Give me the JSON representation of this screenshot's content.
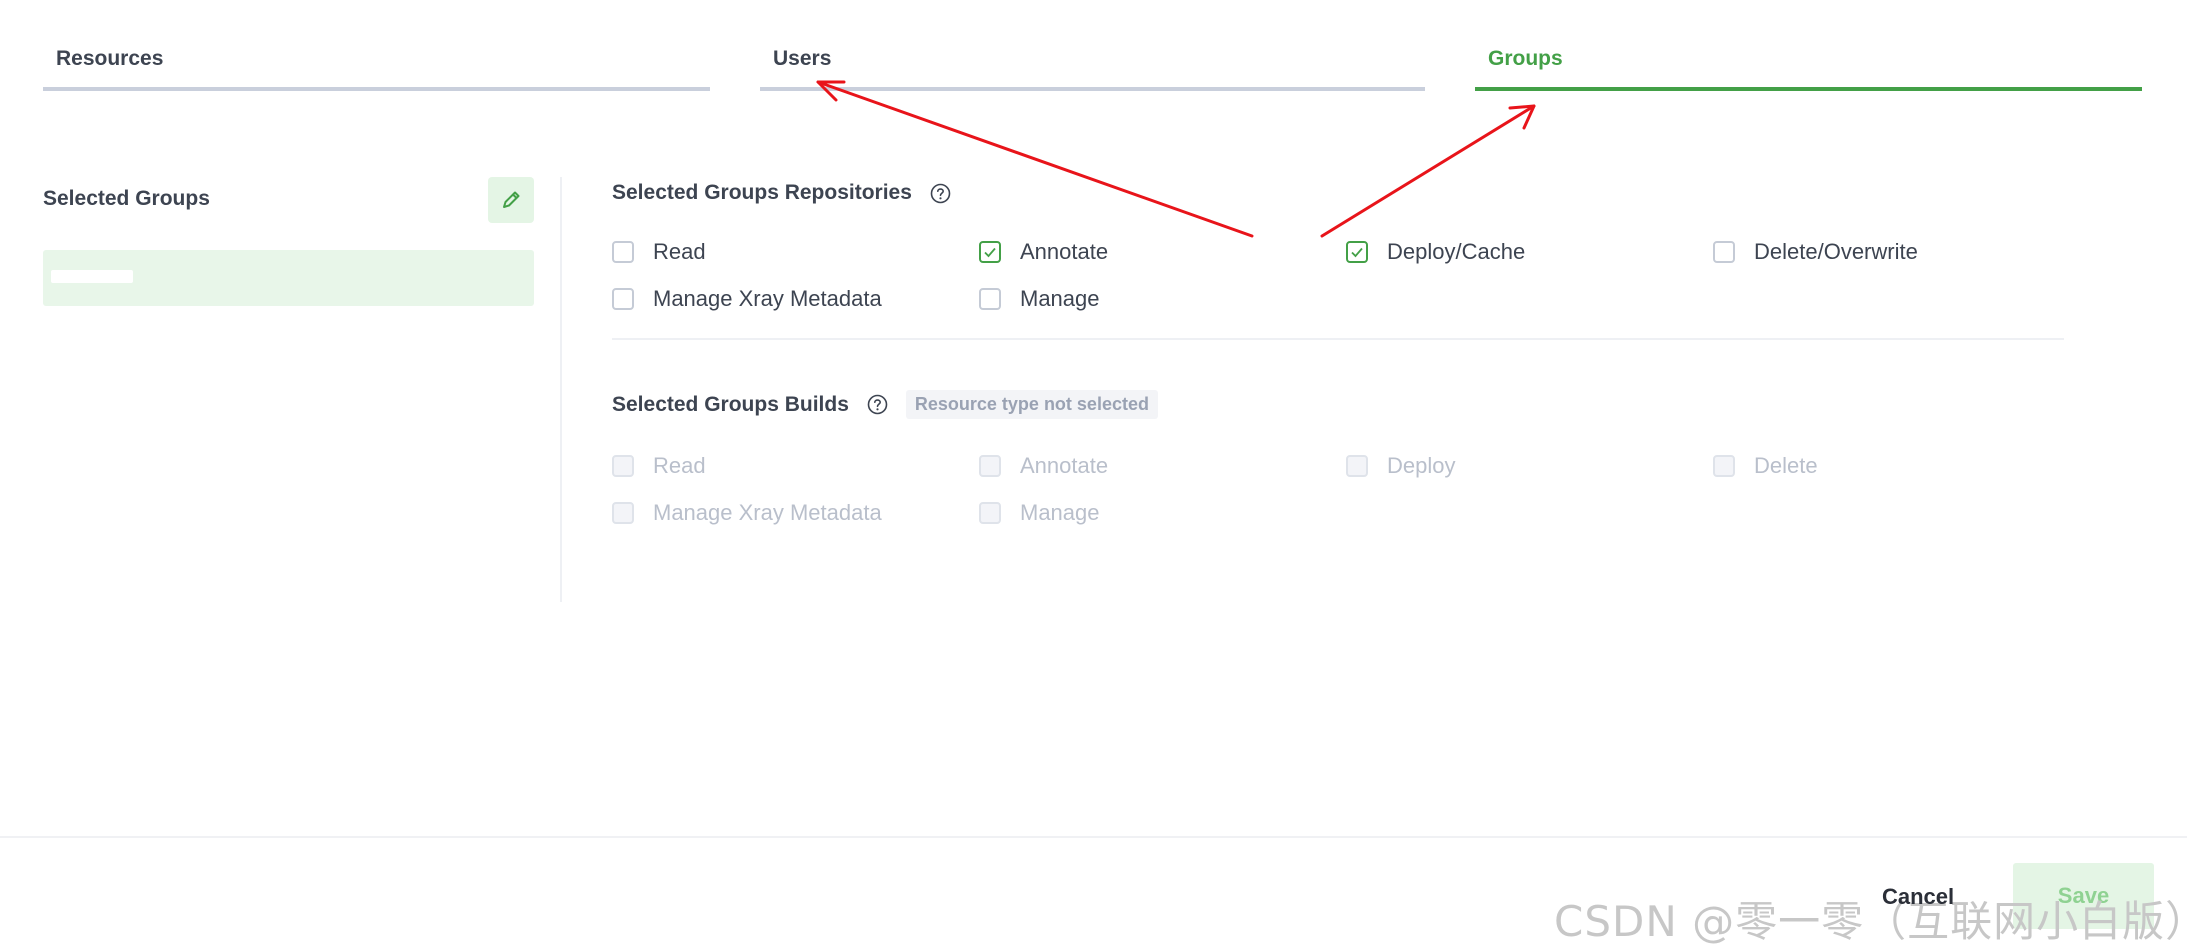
{
  "tabs": [
    {
      "label": "Resources",
      "active": false
    },
    {
      "label": "Users",
      "active": false
    },
    {
      "label": "Groups",
      "active": true
    }
  ],
  "left_panel": {
    "title": "Selected Groups",
    "edit_icon": "pencil-icon",
    "selected_item": ""
  },
  "repositories": {
    "title": "Selected Groups Repositories",
    "help_icon": "question-circle-icon",
    "permissions": [
      {
        "label": "Read",
        "checked": false
      },
      {
        "label": "Annotate",
        "checked": true
      },
      {
        "label": "Deploy/Cache",
        "checked": true
      },
      {
        "label": "Delete/Overwrite",
        "checked": false
      },
      {
        "label": "Manage Xray Metadata",
        "checked": false
      },
      {
        "label": "Manage",
        "checked": false
      }
    ]
  },
  "builds": {
    "title": "Selected Groups Builds",
    "help_icon": "question-circle-icon",
    "badge": "Resource type not selected",
    "permissions": [
      {
        "label": "Read",
        "checked": false,
        "disabled": true
      },
      {
        "label": "Annotate",
        "checked": false,
        "disabled": true
      },
      {
        "label": "Deploy",
        "checked": false,
        "disabled": true
      },
      {
        "label": "Delete",
        "checked": false,
        "disabled": true
      },
      {
        "label": "Manage Xray Metadata",
        "checked": false,
        "disabled": true
      },
      {
        "label": "Manage",
        "checked": false,
        "disabled": true
      }
    ]
  },
  "footer": {
    "cancel_label": "Cancel",
    "save_label": "Save"
  },
  "watermark": "CSDN @零一零（互联网小白版）",
  "colors": {
    "accent": "#43a047",
    "annotation_arrow": "#e8141a",
    "tab_inactive_line": "#c9cfdc"
  }
}
